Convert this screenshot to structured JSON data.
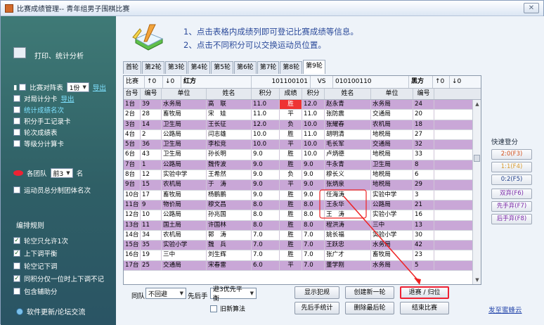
{
  "window": {
    "title": "比赛成绩管理-- 青年组男子围棋比赛"
  },
  "sidebar": {
    "print_label": "打印、统计分析",
    "items": [
      {
        "label": "比赛对阵表",
        "checked": false
      },
      {
        "label": "对局计分卡",
        "checked": false
      },
      {
        "label": "统计成绩名次",
        "checked": false
      },
      {
        "label": "积分手工记录卡",
        "checked": false
      },
      {
        "label": "轮次成绩表",
        "checked": false
      },
      {
        "label": "等级分计算卡",
        "checked": false
      }
    ],
    "round_select": "1份",
    "export1": "导出",
    "export2": "导出",
    "team_label": "各团队",
    "team_select": "前3",
    "team_suffix": "名",
    "team_item": "运动员总分制团体名次",
    "rules_title": "编排规则",
    "rules": [
      {
        "label": "轮空只允许1次",
        "checked": true
      },
      {
        "label": "上下调平衡",
        "checked": true
      },
      {
        "label": "轮空记下调",
        "checked": false
      },
      {
        "label": "同积分仅一位时上下调不记",
        "checked": true
      },
      {
        "label": "包含辅助分",
        "checked": false
      }
    ],
    "footer": "软件更新/论坛交流"
  },
  "info": {
    "line1": "1、点击表格内成绩列即可登记比赛成绩等信息。",
    "line2": "2、点击不同积分可以交换运动员位置。"
  },
  "tabs": [
    "首轮",
    "第2轮",
    "第3轮",
    "第4轮",
    "第5轮",
    "第6轮",
    "第7轮",
    "第8轮",
    "第9轮"
  ],
  "vs_row": {
    "label": "比赛",
    "up": "↑0",
    "down": "↓0",
    "red": "红方",
    "red_id": "101100101",
    "vs": "VS",
    "black_id": "010100110",
    "black": "黑方",
    "up2": "↑0",
    "down2": "↓0"
  },
  "columns": [
    "台号",
    "编号",
    "单位",
    "姓名",
    "积分",
    "成绩",
    "积分",
    "姓名",
    "单位",
    "编号"
  ],
  "rows": [
    [
      "1台",
      "39",
      "水务局",
      "高　联",
      "11.0",
      "胜",
      "12.0",
      "赵永青",
      "水务局",
      "24"
    ],
    [
      "2台",
      "28",
      "畜牧局",
      "宋　娃",
      "11.0",
      "平",
      "11.0",
      "张防震",
      "交通局",
      "20"
    ],
    [
      "3台",
      "14",
      "卫生局",
      "王长征",
      "12.0",
      "负",
      "10.0",
      "张耀春",
      "农机局",
      "18"
    ],
    [
      "4台",
      "2",
      "公路局",
      "闫志雄",
      "10.0",
      "胜",
      "11.0",
      "胡明清",
      "地税局",
      "27"
    ],
    [
      "5台",
      "36",
      "卫生局",
      "李松竞",
      "10.0",
      "平",
      "10.0",
      "毛长军",
      "交通局",
      "32"
    ],
    [
      "6台",
      "43",
      "卫生局",
      "孙长明",
      "9.0",
      "胜",
      "10.0",
      "卢炳德",
      "地税局",
      "33"
    ],
    [
      "7台",
      "1",
      "公路局",
      "魏传波",
      "9.0",
      "胜",
      "9.0",
      "牛永青",
      "卫生局",
      "8"
    ],
    [
      "8台",
      "12",
      "实验中学",
      "王希然",
      "9.0",
      "负",
      "9.0",
      "穆长义",
      "地税局",
      "6"
    ],
    [
      "9台",
      "15",
      "农机局",
      "于　涛",
      "9.0",
      "平",
      "9.0",
      "张炳泉",
      "地税局",
      "29"
    ],
    [
      "10台",
      "17",
      "畜牧局",
      "杨鹏鹏",
      "9.0",
      "胜",
      "9.0",
      "任海涛",
      "实验中学",
      "3"
    ],
    [
      "11台",
      "9",
      "物价局",
      "穆文昌",
      "8.0",
      "胜",
      "8.0",
      "王永华",
      "公路局",
      "21"
    ],
    [
      "12台",
      "10",
      "公路局",
      "孙兆国",
      "8.0",
      "胜",
      "8.0",
      "王　涛",
      "实验小学",
      "16"
    ],
    [
      "13台",
      "11",
      "国土局",
      "许国林",
      "8.0",
      "胜",
      "8.0",
      "程洪涛",
      "三中",
      "13"
    ],
    [
      "14台",
      "34",
      "农机局",
      "郭　涛",
      "7.0",
      "胜",
      "7.0",
      "姚长福",
      "实验小学",
      "30"
    ],
    [
      "15台",
      "35",
      "实验小学",
      "魏　兵",
      "7.0",
      "胜",
      "7.0",
      "王跃忠",
      "水务局",
      "42"
    ],
    [
      "16台",
      "19",
      "三中",
      "刘生辉",
      "7.0",
      "胜",
      "7.0",
      "张广才",
      "畜牧局",
      "23"
    ],
    [
      "17台",
      "25",
      "交通局",
      "宋春雷",
      "6.0",
      "平",
      "7.0",
      "董学刚",
      "水务局",
      "5"
    ]
  ],
  "quick": {
    "title": "快速登分",
    "buttons": [
      "2:0(F3)",
      "1:1(F4)",
      "0:2(F5)",
      "双弃(F6)",
      "先手弃(F7)",
      "后手弃(F8)"
    ]
  },
  "bottom": {
    "same_team_label": "同队",
    "same_team_value": "不回避",
    "order_label": "先后手",
    "order_value": "避3优先平衡",
    "old_algo": "旧新算法",
    "btn_show_fouls": "显示犯规",
    "btn_create_round": "创建新一轮",
    "btn_withdraw": "退赛 / 归位",
    "btn_order_stats": "先后手统计",
    "btn_delete_last": "删除最后轮",
    "btn_end": "结束比赛",
    "link": "发至蜜蜂云"
  },
  "colors": {
    "sidebar": "#2f5f66",
    "odd_row": "#c9a7d7",
    "win": "#e33333",
    "info_text": "#2b4a9a",
    "highlight": "#e22233"
  }
}
